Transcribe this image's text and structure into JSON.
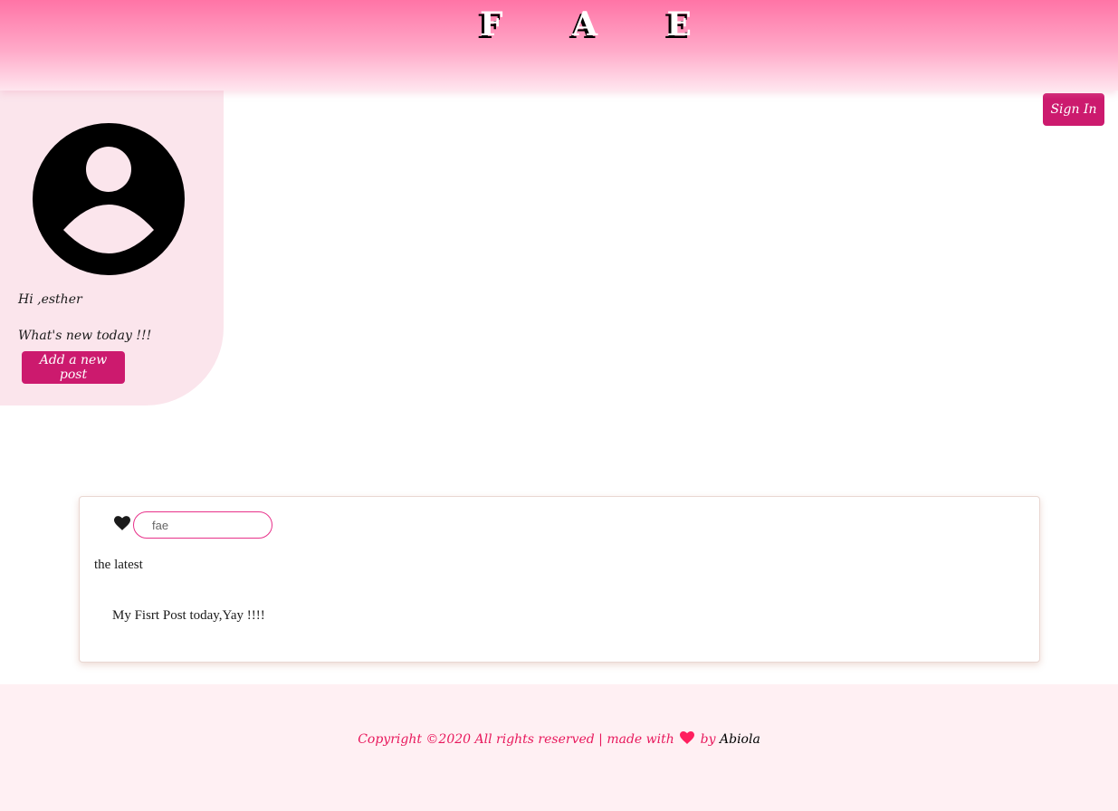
{
  "header": {
    "brand": "F A E"
  },
  "auth": {
    "signin_label": "Sign In"
  },
  "sidebar": {
    "avatar_icon": "user-circle-icon",
    "greeting": "Hi ,esther",
    "prompt": "What's new today !!!",
    "add_post_label": "Add a new post"
  },
  "post": {
    "like_icon": "heart-icon",
    "name_value": "fae",
    "title": "the latest",
    "body": "My Fisrt Post today,Yay !!!!"
  },
  "footer": {
    "text_before": "Copyright ©2020 All rights reserved | made with",
    "heart_icon": "heart-icon",
    "text_by": "by",
    "author": "Abiola"
  },
  "colors": {
    "accent": "#cc1a6e",
    "footer_text": "#e8185c",
    "header_top": "#ff74a6",
    "sidebar_bg": "#fbe5ec",
    "footer_bg": "#fff0f3"
  }
}
